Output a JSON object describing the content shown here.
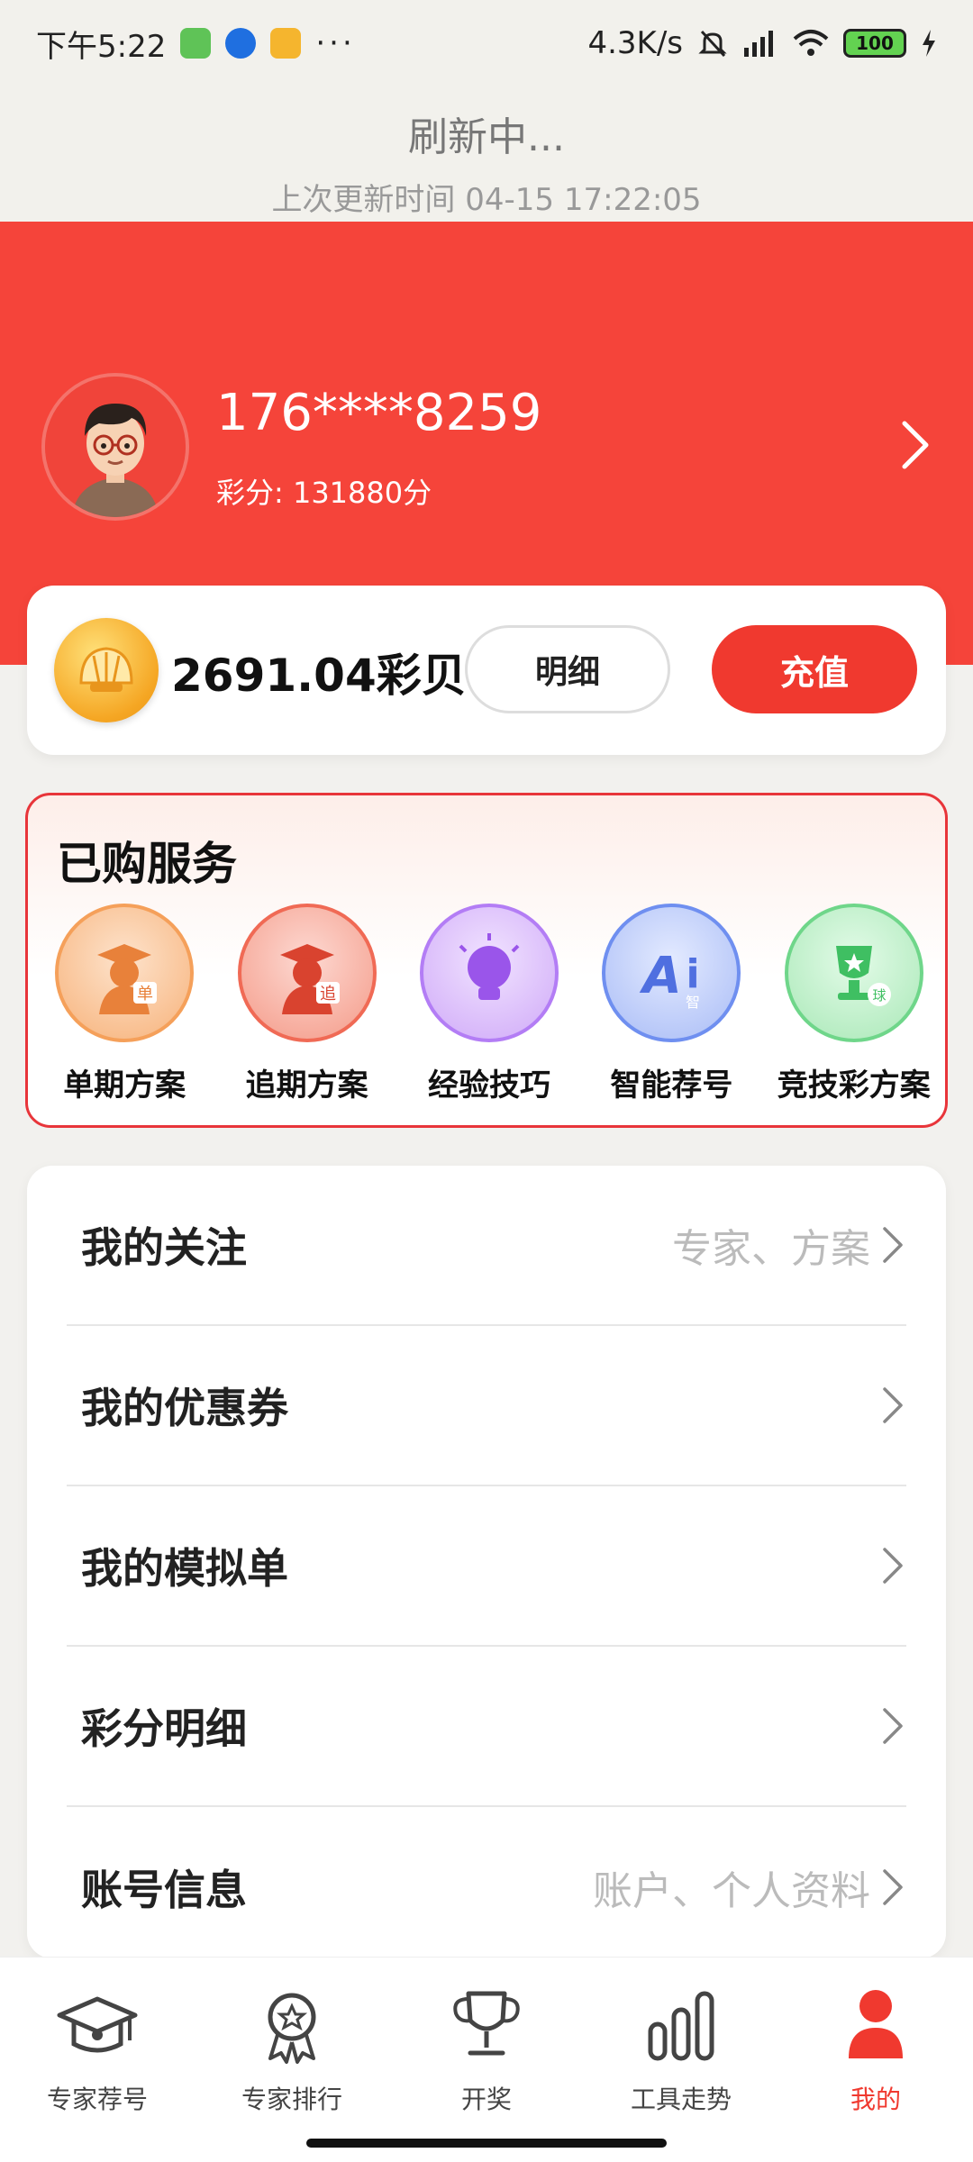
{
  "status_bar": {
    "time": "下午5:22",
    "net_speed": "4.3K/s",
    "battery": "100"
  },
  "refresh": {
    "title": "刷新中...",
    "last_update": "上次更新时间 04-15 17:22:05"
  },
  "profile": {
    "phone": "176****8259",
    "points": "彩分: 131880分"
  },
  "wallet": {
    "balance": "2691.04彩贝",
    "detail_label": "明细",
    "recharge_label": "充值"
  },
  "services": {
    "title": "已购服务",
    "items": [
      {
        "label": "单期方案",
        "icon": "expert-single-icon",
        "color": "#f5a05a"
      },
      {
        "label": "追期方案",
        "icon": "expert-chase-icon",
        "color": "#f06a55"
      },
      {
        "label": "经验技巧",
        "icon": "lightbulb-icon",
        "color": "#b37df5"
      },
      {
        "label": "智能荐号",
        "icon": "ai-icon",
        "color": "#6f8ff0"
      },
      {
        "label": "竞技彩方案",
        "icon": "trophy-icon",
        "color": "#6fd68a"
      }
    ]
  },
  "menu": [
    {
      "label": "我的关注",
      "hint": "专家、方案"
    },
    {
      "label": "我的优惠券",
      "hint": ""
    },
    {
      "label": "我的模拟单",
      "hint": ""
    },
    {
      "label": "彩分明细",
      "hint": ""
    },
    {
      "label": "账号信息",
      "hint": "账户、个人资料"
    }
  ],
  "tabs": [
    {
      "label": "专家荐号",
      "icon": "graduation-cap-icon"
    },
    {
      "label": "专家排行",
      "icon": "medal-icon"
    },
    {
      "label": "开奖",
      "icon": "trophy-icon"
    },
    {
      "label": "工具走势",
      "icon": "bar-chart-icon"
    },
    {
      "label": "我的",
      "icon": "user-icon"
    }
  ],
  "colors": {
    "brand_red": "#f5443a",
    "accent_red": "#f0392f"
  }
}
